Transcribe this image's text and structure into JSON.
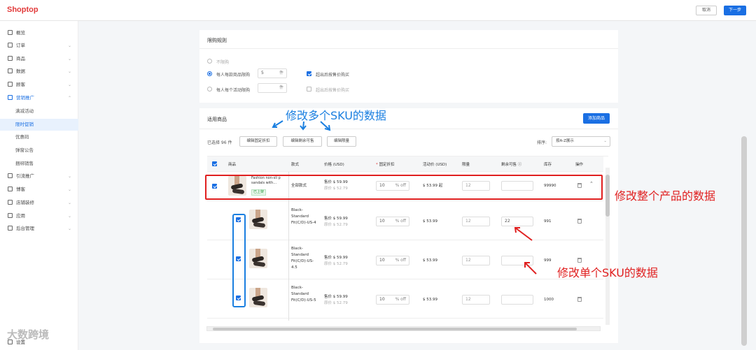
{
  "app": {
    "logo": "Shoptop",
    "cancel": "取消",
    "next": "下一步"
  },
  "sidebar": {
    "items": [
      {
        "label": "概览",
        "icon": "dashboard-icon"
      },
      {
        "label": "订单",
        "icon": "orders-icon"
      },
      {
        "label": "商品",
        "icon": "products-icon"
      },
      {
        "label": "数据",
        "icon": "data-icon"
      },
      {
        "label": "顾客",
        "icon": "customers-icon"
      },
      {
        "label": "营销推广",
        "icon": "tag-icon"
      },
      {
        "label": "满减活动"
      },
      {
        "label": "限时促销"
      },
      {
        "label": "优惠码"
      },
      {
        "label": "弹窗公告"
      },
      {
        "label": "捆绑销售"
      },
      {
        "label": "引流推广",
        "icon": "traffic-icon"
      },
      {
        "label": "博客",
        "icon": "blog-icon"
      },
      {
        "label": "店铺装修",
        "icon": "store-design-icon"
      },
      {
        "label": "应用",
        "icon": "apps-icon"
      },
      {
        "label": "后台管理",
        "icon": "admin-icon"
      },
      {
        "label": "设置",
        "icon": "settings-icon"
      }
    ]
  },
  "limit": {
    "title": "限购规则",
    "opt1": "不限购",
    "opt2": "每人每款商品限购",
    "opt2_value": "5",
    "opt2_unit": "件",
    "opt2_check": "超出后按售价购买",
    "opt3": "每人每个活动限购",
    "opt3_unit": "件",
    "opt3_check": "超出后按售价购买"
  },
  "products": {
    "title": "适用商品",
    "add_button": "添加商品",
    "selected": "已选择 96 件",
    "bulk_discount": "编辑固定折扣",
    "bulk_remaining": "编辑剩余可售",
    "bulk_limit": "编辑限量",
    "sort_label": "排序:",
    "sort_value": "按A-Z展示",
    "headers": {
      "product": "商品",
      "variant": "款式",
      "price": "价格 (USD)",
      "discount_req": "*",
      "discount": "固定折扣",
      "promo_price": "活动价 (USD)",
      "limit": "限量",
      "remaining": "剩余可售 ⓘ",
      "stock": "库存",
      "action": "操作"
    },
    "parent": {
      "name": "Fashion non-sli p sandals with...",
      "status": "已上架",
      "variant": "全部款式",
      "price": "售价 $ 59.99",
      "compare": "原价 $ 52.79",
      "discount": "10",
      "discount_unit": "% off",
      "promo_price": "$ 53.99 起",
      "limit": "12",
      "remaining": "",
      "stock": "99990"
    },
    "variants": [
      {
        "variant": "Black-Standard Fit(C/D)-US-4",
        "price": "售价 $ 59.99",
        "compare": "原价 $ 52.79",
        "discount": "10",
        "discount_unit": "% off",
        "promo_price": "$ 53.99",
        "limit": "12",
        "remaining": "22",
        "stock": "991"
      },
      {
        "variant": "Black-Standard Fit(C/D)-US-4.5",
        "price": "售价 $ 59.99",
        "compare": "原价 $ 52.79",
        "discount": "10",
        "discount_unit": "% off",
        "promo_price": "$ 53.99",
        "limit": "12",
        "remaining": "",
        "stock": "999"
      },
      {
        "variant": "Black-Standard Fit(C/D)-US-5",
        "price": "售价 $ 59.99",
        "compare": "原价 $ 52.79",
        "discount": "10",
        "discount_unit": "% off",
        "promo_price": "$ 53.99",
        "limit": "12",
        "remaining": "",
        "stock": "1000"
      },
      {
        "variant": "Black-"
      }
    ]
  },
  "annotations": {
    "multi_sku": "修改多个SKU的数据",
    "whole_product": "修改整个产品的数据",
    "single_sku": "修改单个SKU的数据"
  },
  "watermark": "大数跨境",
  "colors": {
    "primary": "#1a6fe3",
    "annotation_blue": "#1a7fe0",
    "annotation_red": "#e02020",
    "logo_red": "#e23a3a"
  }
}
